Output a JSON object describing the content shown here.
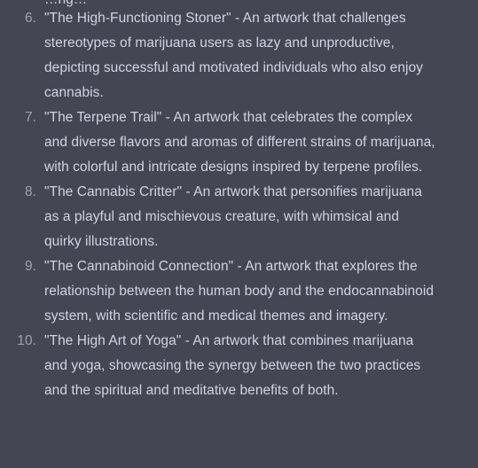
{
  "response": {
    "clipped_top_text": "…ng…",
    "items": [
      {
        "number": "6.",
        "text": "\"The High-Functioning Stoner\" - An artwork that challenges stereotypes of marijuana users as lazy and unproductive, depicting successful and motivated individuals who also enjoy cannabis."
      },
      {
        "number": "7.",
        "text": "\"The Terpene Trail\" - An artwork that celebrates the complex and diverse flavors and aromas of different strains of marijuana, with colorful and intricate designs inspired by terpene profiles."
      },
      {
        "number": "8.",
        "text": "\"The Cannabis Critter\" - An artwork that personifies marijuana as a playful and mischievous creature, with whimsical and quirky illustrations."
      },
      {
        "number": "9.",
        "text": "\"The Cannabinoid Connection\" - An artwork that explores the relationship between the human body and the endocannabinoid system, with scientific and medical themes and imagery."
      },
      {
        "number": "10.",
        "text": "\"The High Art of Yoga\" - An artwork that combines marijuana and yoga, showcasing the synergy between the two practices and the spiritual and meditative benefits of both."
      }
    ]
  },
  "colors": {
    "background": "#444654",
    "text": "#d1d5db",
    "list_number": "#9ca3af"
  }
}
